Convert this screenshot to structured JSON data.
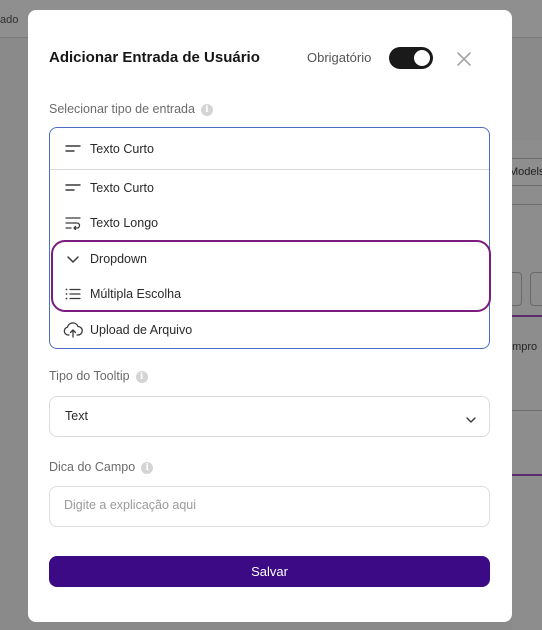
{
  "background": {
    "top_fragment": "ado",
    "chip_fragment": "Models",
    "mid_fragment": "ompro"
  },
  "modal": {
    "title": "Adicionar Entrada de Usuário",
    "required_label": "Obrigatório",
    "required_on": true
  },
  "input_type": {
    "label": "Selecionar tipo de entrada",
    "selected": "Texto Curto",
    "options": [
      {
        "label": "Texto Curto",
        "icon": "short-text-icon"
      },
      {
        "label": "Texto Longo",
        "icon": "long-text-icon"
      },
      {
        "label": "Dropdown",
        "icon": "chevron-down-icon"
      },
      {
        "label": "Múltipla Escolha",
        "icon": "list-icon"
      },
      {
        "label": "Upload de Arquivo",
        "icon": "cloud-upload-icon"
      }
    ]
  },
  "tooltip_type": {
    "label": "Tipo do Tooltip",
    "value": "Text"
  },
  "field_hint": {
    "label": "Dica do Campo",
    "placeholder": "Digite a explicação aqui",
    "value": ""
  },
  "save_label": "Salvar",
  "colors": {
    "primary": "#3b0a84",
    "highlight": "#7a1e7e",
    "focus_border": "#4a6cc4"
  }
}
